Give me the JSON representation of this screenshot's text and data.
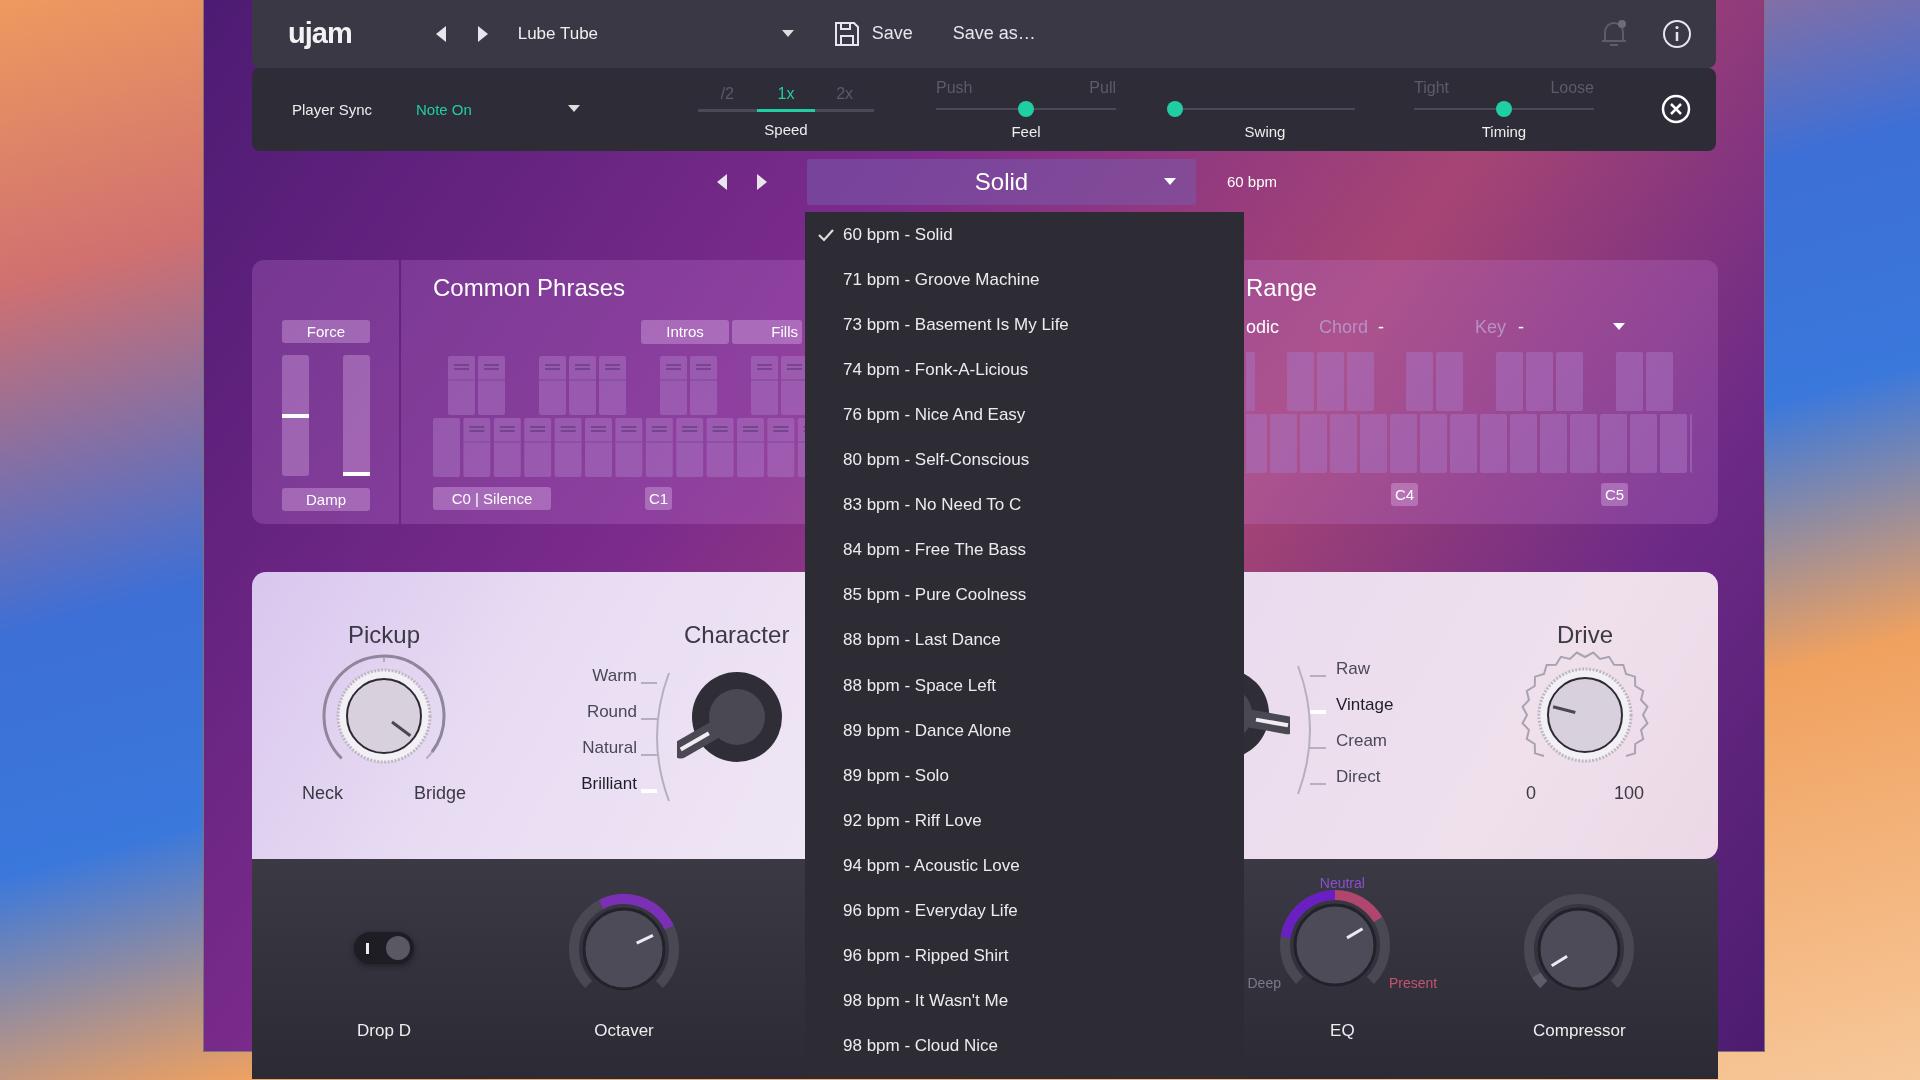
{
  "toolbar": {
    "logo": "ujam",
    "preset": "Lube Tube",
    "save": "Save",
    "save_as": "Save as…"
  },
  "sync_bar": {
    "player_sync_label": "Player Sync",
    "player_sync_value": "Note On",
    "speed_label": "Speed",
    "speed_options": [
      {
        "label": "/2",
        "selected": false
      },
      {
        "label": "1x",
        "selected": true
      },
      {
        "label": "2x",
        "selected": false
      }
    ],
    "sliders": [
      {
        "label": "Feel",
        "left": "Push",
        "right": "Pull",
        "level": 0.5
      },
      {
        "label": "Swing",
        "level": 0.0
      },
      {
        "label": "Timing",
        "left": "Tight",
        "right": "Loose",
        "level": 0.5
      }
    ]
  },
  "style_row": {
    "style": "Solid",
    "tempo": "60 bpm"
  },
  "style_menu": [
    {
      "label": "60 bpm - Solid",
      "selected": true
    },
    {
      "label": "71 bpm - Groove Machine",
      "selected": false
    },
    {
      "label": "73 bpm - Basement Is My Life",
      "selected": false
    },
    {
      "label": "74 bpm - Fonk-A-Licious",
      "selected": false
    },
    {
      "label": "76 bpm - Nice And Easy",
      "selected": false
    },
    {
      "label": "80 bpm - Self-Conscious",
      "selected": false
    },
    {
      "label": "83 bpm - No Need To C",
      "selected": false
    },
    {
      "label": "84 bpm - Free The Bass",
      "selected": false
    },
    {
      "label": "85 bpm - Pure Coolness",
      "selected": false
    },
    {
      "label": "88 bpm - Last Dance",
      "selected": false
    },
    {
      "label": "88 bpm - Space Left",
      "selected": false
    },
    {
      "label": "89 bpm - Dance Alone",
      "selected": false
    },
    {
      "label": "89 bpm - Solo",
      "selected": false
    },
    {
      "label": "92 bpm - Riff Love",
      "selected": false
    },
    {
      "label": "94 bpm - Acoustic Love",
      "selected": false
    },
    {
      "label": "96 bpm - Everyday Life",
      "selected": false
    },
    {
      "label": "96 bpm - Ripped Shirt",
      "selected": false
    },
    {
      "label": "98 bpm - It Wasn't Me",
      "selected": false
    },
    {
      "label": "98 bpm - Cloud Nice",
      "selected": false
    }
  ],
  "force_damp": {
    "top_label": "Force",
    "bottom_label": "Damp",
    "force": {
      "level": 0.5
    },
    "damp": {
      "level": 0.02
    }
  },
  "phrases": {
    "title": "Common Phrases",
    "groups": [
      "Intros",
      "Fills"
    ],
    "notes": [
      "C0 | Silence",
      "C1"
    ]
  },
  "range": {
    "title": "Range",
    "mode": "odic",
    "chord_label": "Chord",
    "chord_value": "-",
    "key_label": "Key",
    "key_value": "-",
    "notes": [
      "C4",
      "C5"
    ]
  },
  "pickup": {
    "title": "Pickup",
    "left": "Neck",
    "right": "Bridge",
    "level": 0.97
  },
  "character": {
    "title": "Character",
    "options": [
      {
        "label": "Warm",
        "selected": false
      },
      {
        "label": "Round",
        "selected": false
      },
      {
        "label": "Natural",
        "selected": false
      },
      {
        "label": "Brilliant",
        "selected": true
      }
    ]
  },
  "amp": {
    "options": [
      {
        "label": "Raw",
        "selected": false
      },
      {
        "label": "Vintage",
        "selected": true
      },
      {
        "label": "Cream",
        "selected": false
      },
      {
        "label": "Direct",
        "selected": false
      }
    ]
  },
  "drive": {
    "title": "Drive",
    "min": "0",
    "max": "100",
    "level": 0.22
  },
  "bottom_left": [
    {
      "kind": "toggle",
      "label": "Drop D",
      "on": true
    },
    {
      "kind": "knob",
      "label": "Octaver",
      "level": 0.74
    }
  ],
  "bottom_right": [
    {
      "kind": "eq",
      "label": "EQ",
      "top": "Neutral",
      "left": "Deep",
      "right": "Present",
      "level": 0.72
    },
    {
      "kind": "knob",
      "label": "Compressor",
      "level": 0.05
    }
  ]
}
